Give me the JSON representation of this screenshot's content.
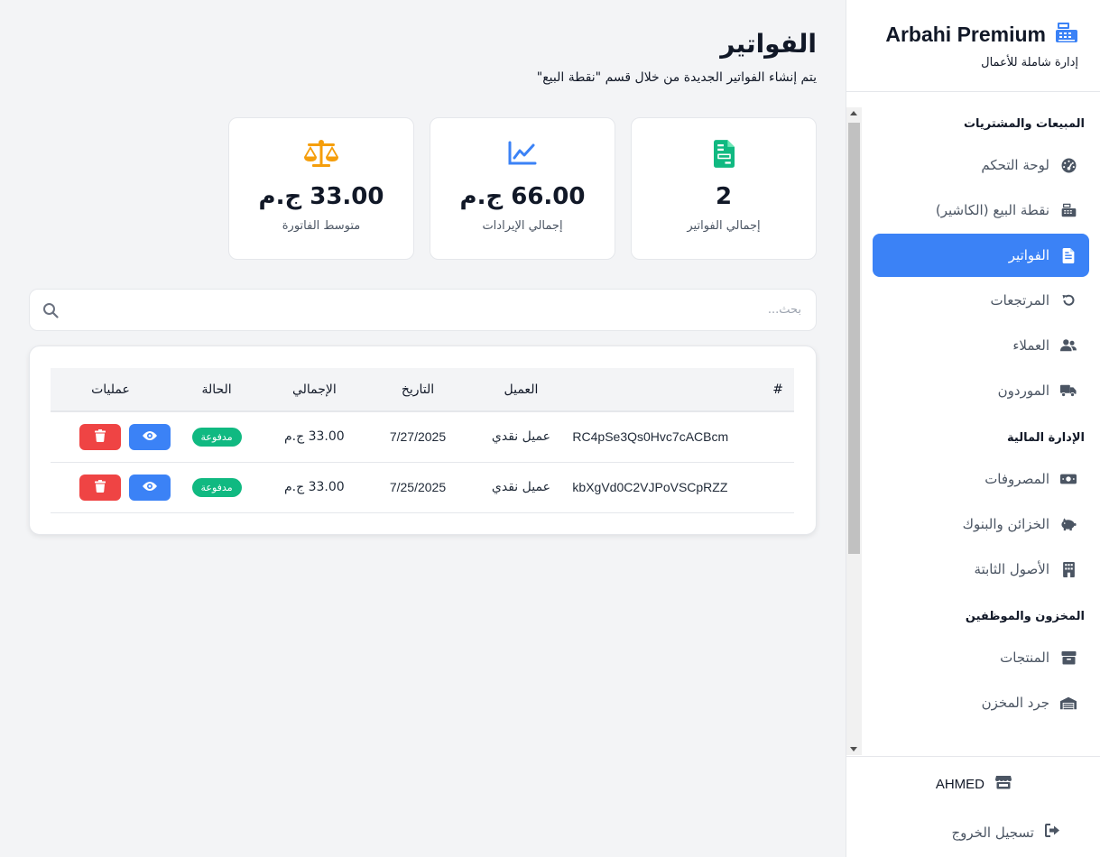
{
  "brand": {
    "name": "Arbahi Premium",
    "subtitle": "إدارة شاملة للأعمال"
  },
  "sidebar": {
    "sections": [
      {
        "title": "المبيعات والمشتريات"
      },
      {
        "title": "الإدارة المالية"
      },
      {
        "title": "المخزون والموظفين"
      }
    ],
    "items": [
      {
        "label": "لوحة التحكم",
        "icon": "dashboard-icon"
      },
      {
        "label": "نقطة البيع (الكاشير)",
        "icon": "cash-register-icon"
      },
      {
        "label": "الفواتير",
        "icon": "invoice-icon",
        "active": true
      },
      {
        "label": "المرتجعات",
        "icon": "undo-icon"
      },
      {
        "label": "العملاء",
        "icon": "users-icon"
      },
      {
        "label": "الموردون",
        "icon": "truck-icon"
      },
      {
        "label": "المصروفات",
        "icon": "money-icon"
      },
      {
        "label": "الخزائن والبنوك",
        "icon": "piggy-bank-icon"
      },
      {
        "label": "الأصول الثابتة",
        "icon": "building-icon"
      },
      {
        "label": "المنتجات",
        "icon": "box-icon"
      },
      {
        "label": "جرد المخزن",
        "icon": "warehouse-icon"
      }
    ],
    "user": "AHMED",
    "logout": "تسجيل الخروج"
  },
  "page": {
    "title": "الفواتير",
    "subtitle": "يتم إنشاء الفواتير الجديدة من خلال قسم \"نقطة البيع\""
  },
  "stats": [
    {
      "value": "2",
      "label": "إجمالي الفواتير",
      "icon": "file-invoice-icon",
      "color": "#10b981"
    },
    {
      "value": "66.00 ج.م",
      "label": "إجمالي الإيرادات",
      "icon": "chart-line-icon",
      "color": "#3b82f6"
    },
    {
      "value": "33.00 ج.م",
      "label": "متوسط الفاتورة",
      "icon": "scale-icon",
      "color": "#f59e0b"
    }
  ],
  "search": {
    "placeholder": "بحث...",
    "value": ""
  },
  "table": {
    "headers": {
      "id": "#",
      "customer": "العميل",
      "date": "التاريخ",
      "total": "الإجمالي",
      "status": "الحالة",
      "actions": "عمليات"
    },
    "rows": [
      {
        "id": "RC4pSe3Qs0Hvc7cACBcm",
        "customer": "عميل نقدي",
        "date": "7/27/2025",
        "total": "33.00 ج.م",
        "status": "مدفوعة"
      },
      {
        "id": "kbXgVd0C2VJPoVSCpRZZ",
        "customer": "عميل نقدي",
        "date": "7/25/2025",
        "total": "33.00 ج.م",
        "status": "مدفوعة"
      }
    ]
  },
  "colors": {
    "primary": "#3b82f6",
    "danger": "#ef4444",
    "success": "#10b981",
    "warning": "#f59e0b"
  }
}
